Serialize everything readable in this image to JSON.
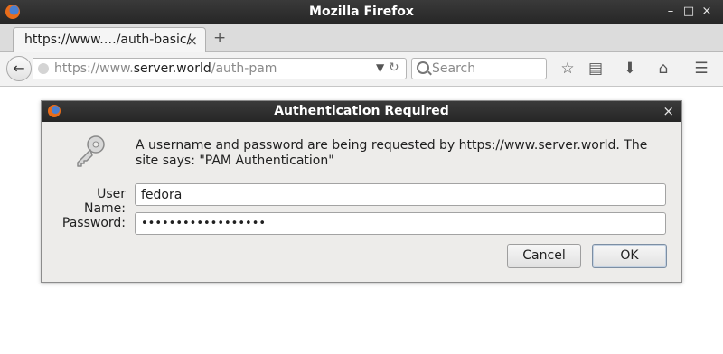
{
  "window": {
    "title": "Mozilla Firefox",
    "controls": {
      "minimize": "–",
      "maximize": "□",
      "close": "×"
    }
  },
  "tabs": [
    {
      "label": "https://www.…/auth-basic/",
      "close": "×"
    }
  ],
  "new_tab_symbol": "+",
  "navbar": {
    "back_symbol": "←",
    "url_prefix": "https://www.",
    "url_host": "server.world",
    "url_path": "/auth-pam",
    "search_placeholder": "Search"
  },
  "toolbar_icons": [
    "bookmark-star-icon",
    "reading-list-icon",
    "downloads-icon",
    "home-icon",
    "menu-icon"
  ],
  "dialog": {
    "title": "Authentication Required",
    "close": "×",
    "message": "A username and password are being requested by https://www.server.world. The site says: \"PAM Authentication\"",
    "username_label": "User Name:",
    "username_value": "fedora",
    "password_label": "Password:",
    "password_mask": "••••••••••••••••••",
    "cancel_label": "Cancel",
    "ok_label": "OK"
  }
}
